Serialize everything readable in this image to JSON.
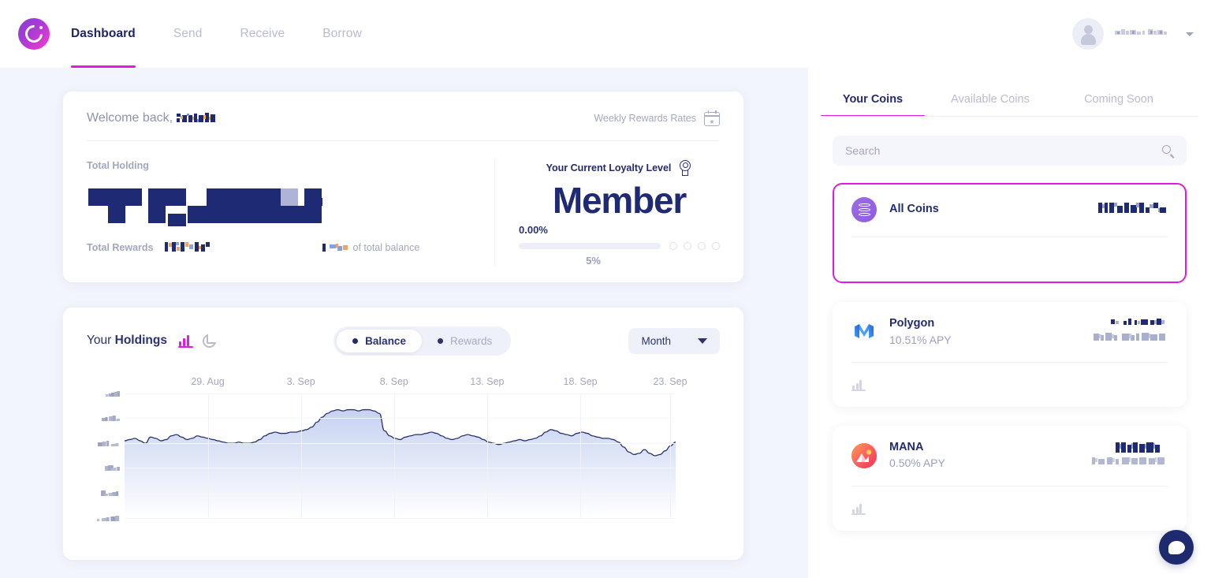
{
  "brand": {
    "logo_icon": "celsius-logo-icon",
    "accent": "#e11ae1",
    "navy": "#232a6e",
    "purple": "#8f5ce0"
  },
  "nav": {
    "items": [
      {
        "label": "Dashboard",
        "active": true
      },
      {
        "label": "Send",
        "active": false
      },
      {
        "label": "Receive",
        "active": false
      },
      {
        "label": "Borrow",
        "active": false
      }
    ],
    "account": {
      "avatar_icon": "user-avatar-icon",
      "name_redacted": true,
      "caret_icon": "chevron-down-icon"
    }
  },
  "welcome": {
    "greeting": "Welcome back,",
    "user_name_redacted": true,
    "weekly_rewards_label": "Weekly Rewards Rates",
    "calendar_icon": "calendar-star-icon",
    "total_holding_label": "Total Holding",
    "total_holding_value_redacted": true,
    "total_rewards_label": "Total Rewards",
    "total_rewards_value_redacted": true,
    "of_total_balance_label": "of total balance",
    "of_total_balance_value_redacted": true
  },
  "loyalty": {
    "title": "Your Current Loyalty Level",
    "medal_icon": "medal-icon",
    "level": "Member",
    "current_pct": "0.00%",
    "next_pct": "5%",
    "progress_value": 0,
    "tier_dots": 4
  },
  "holdings": {
    "title_prefix": "Your",
    "title_bold": "Holdings",
    "bar_chart_icon": "bar-chart-icon",
    "pie_chart_icon": "pie-chart-icon",
    "toggle": [
      {
        "label": "Balance",
        "active": true
      },
      {
        "label": "Rewards",
        "active": false
      }
    ],
    "range": {
      "selected": "Month",
      "caret_icon": "chevron-down-icon"
    }
  },
  "chart_data": {
    "type": "area",
    "title": "Your Holdings",
    "xlabel": "",
    "ylabel": "",
    "grid": true,
    "legend": "none",
    "line_color": "#26306f",
    "fill_from": "#ccd6f2",
    "fill_to": "#ffffff",
    "tick_labels_redacted": true,
    "x_tick_labels": [
      "29. Aug",
      "3. Sep",
      "8. Sep",
      "13. Sep",
      "18. Sep",
      "23. Sep"
    ],
    "x_tick_positions_pct": [
      15.1,
      32.0,
      48.9,
      65.8,
      82.7,
      99.0
    ],
    "y_tick_count": 6,
    "ylim": [
      0,
      100
    ],
    "y_values": [
      62,
      63,
      64,
      62,
      60,
      65,
      64,
      62,
      63,
      66,
      67,
      65,
      63,
      64,
      66,
      65,
      64,
      63,
      62,
      61,
      60,
      60,
      61,
      60,
      60,
      61,
      63,
      66,
      68,
      69,
      68,
      68,
      69,
      69,
      70,
      71,
      73,
      77,
      81,
      84,
      86,
      87,
      86,
      87,
      87,
      86,
      87,
      87,
      86,
      84,
      70,
      66,
      64,
      63,
      65,
      66,
      67,
      67,
      68,
      69,
      68,
      66,
      64,
      63,
      64,
      66,
      67,
      66,
      65,
      63,
      61,
      60,
      59,
      60,
      61,
      62,
      63,
      62,
      63,
      64,
      66,
      69,
      71,
      70,
      68,
      67,
      66,
      68,
      69,
      68,
      66,
      65,
      64,
      64,
      63,
      61,
      57,
      53,
      51,
      52,
      55,
      52,
      50,
      51,
      54,
      58,
      61
    ]
  },
  "coin_panel": {
    "tabs": [
      {
        "label": "Your Coins",
        "active": true
      },
      {
        "label": "Available Coins",
        "active": false
      },
      {
        "label": "Coming Soon",
        "active": false
      }
    ],
    "search": {
      "placeholder": "Search",
      "value": "",
      "icon": "search-icon"
    },
    "cards": [
      {
        "name": "All Coins",
        "icon": "coins-stack-icon",
        "apy": "",
        "value_redacted": true,
        "sub_redacted": false,
        "selected": true,
        "footer_icon": ""
      },
      {
        "name": "Polygon",
        "icon": "polygon-matic-icon",
        "apy": "10.51% APY",
        "value_redacted": true,
        "sub_redacted": true,
        "selected": false,
        "footer_icon": "bar-chart-icon"
      },
      {
        "name": "MANA",
        "icon": "decentraland-mana-icon",
        "apy": "0.50% APY",
        "value_redacted": true,
        "sub_redacted": true,
        "selected": false,
        "footer_icon": "bar-chart-icon"
      }
    ]
  },
  "chat": {
    "icon": "chat-bubble-icon"
  }
}
